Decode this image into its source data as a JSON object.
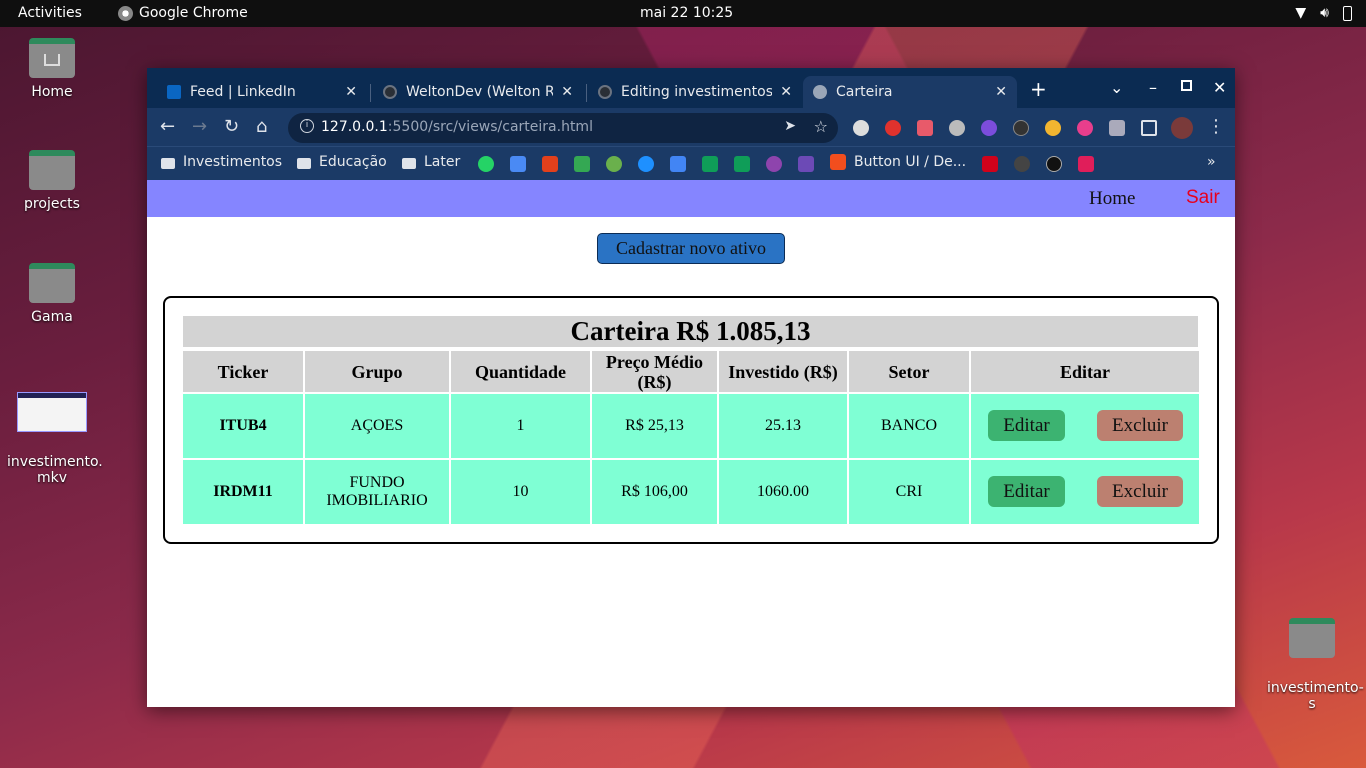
{
  "topbar": {
    "activities": "Activities",
    "app": "Google Chrome",
    "clock": "mai 22  10:25"
  },
  "desktop": [
    {
      "label": "Home"
    },
    {
      "label": "projects"
    },
    {
      "label": "Gama"
    },
    {
      "label": "investimento.\nmkv"
    },
    {
      "label": "investimento-\ns"
    }
  ],
  "browser": {
    "tabs": [
      {
        "title": "Feed | LinkedIn",
        "icon": "linkedin-icon"
      },
      {
        "title": "WeltonDev (Welton Ro",
        "icon": "github-icon"
      },
      {
        "title": "Editing investimentos/",
        "icon": "github-icon"
      },
      {
        "title": "Carteira",
        "icon": "globe-icon"
      }
    ],
    "url_host": "127.0.0.1",
    "url_path": ":5500/src/views/carteira.html",
    "bookmarks": [
      "Investimentos",
      "Educação",
      "Later",
      "Button UI / De..."
    ],
    "colors": {
      "tabstrip": "#0b2b52",
      "toolbar": "#1b3a66"
    }
  },
  "page": {
    "nav": {
      "home": "Home",
      "sair": "Sair"
    },
    "cadastrar": "Cadastrar novo ativo",
    "caption": "Carteira R$ 1.085,13",
    "headers": [
      "Ticker",
      "Grupo",
      "Quantidade",
      "Preço Médio (R$)",
      "Investido (R$)",
      "Setor",
      "Editar"
    ],
    "rows": [
      {
        "ticker": "ITUB4",
        "grupo": "AÇOES",
        "quantidade": "1",
        "preco": "R$ 25,13",
        "investido": "25.13",
        "setor": "BANCO"
      },
      {
        "ticker": "IRDM11",
        "grupo": "FUNDO IMOBILIARIO",
        "quantidade": "10",
        "preco": "R$ 106,00",
        "investido": "1060.00",
        "setor": "CRI"
      }
    ],
    "editar": "Editar",
    "excluir": "Excluir",
    "colors": {
      "nav": "#8585ff",
      "row": "#7fffd4",
      "header": "#d3d3d3",
      "edit": "#3cb371",
      "delete": "#bc8070",
      "sair": "#e8001c"
    }
  }
}
